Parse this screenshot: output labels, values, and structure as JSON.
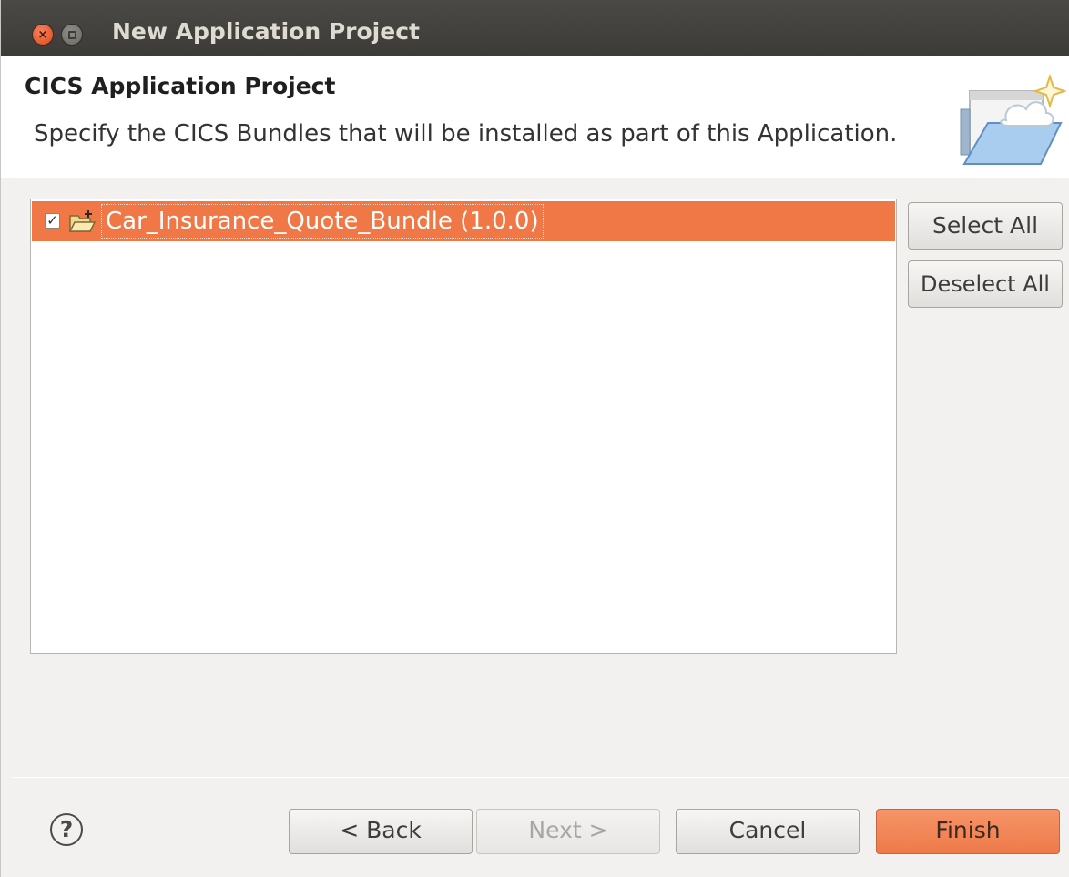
{
  "window": {
    "title": "New Application Project"
  },
  "header": {
    "title": "CICS Application Project",
    "description": "Specify the CICS Bundles that will be installed as part of this Application."
  },
  "bundle_list": {
    "items": [
      {
        "label": "Car_Insurance_Quote_Bundle (1.0.0)",
        "checked": true,
        "selected": true
      }
    ]
  },
  "side_buttons": {
    "select_all": "Select All",
    "deselect_all": "Deselect All"
  },
  "footer": {
    "help_symbol": "?",
    "back": "< Back",
    "next": "Next >",
    "cancel": "Cancel",
    "finish": "Finish"
  },
  "colors": {
    "accent": "#f07746",
    "titlebar": "#3c3b37"
  },
  "icons": {
    "close": "close-icon",
    "minimize": "minimize-icon",
    "bundle": "bundle-folder-icon",
    "banner": "wizard-banner-icon",
    "help": "help-icon"
  }
}
